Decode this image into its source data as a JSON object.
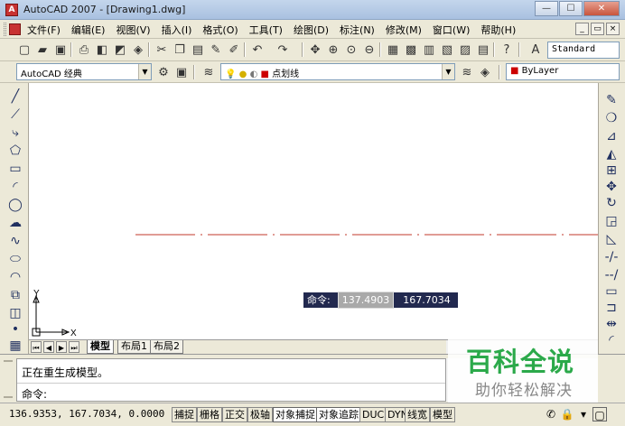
{
  "window": {
    "title": "AutoCAD 2007 - [Drawing1.dwg]"
  },
  "menubar": {
    "items": [
      "文件(F)",
      "编辑(E)",
      "视图(V)",
      "插入(I)",
      "格式(O)",
      "工具(T)",
      "绘图(D)",
      "标注(N)",
      "修改(M)",
      "窗口(W)",
      "帮助(H)"
    ]
  },
  "toolbar1": {
    "text_style": "Standard"
  },
  "toolbar2": {
    "workspace": "AutoCAD 经典",
    "layer": "点划线",
    "color": "ByLayer"
  },
  "canvas": {
    "ucs": {
      "x": "X",
      "y": "Y"
    },
    "dynamic_input": {
      "label": "命令:",
      "value1": "137.4903",
      "value2": "167.7034"
    },
    "centerline_color": "#c0392b"
  },
  "tabs": {
    "model": "模型",
    "layout1": "布局1",
    "layout2": "布局2"
  },
  "command": {
    "history": "正在重生成模型。",
    "prompt": "命令:"
  },
  "status": {
    "coords": "136.9353,  167.7034, 0.0000",
    "buttons": [
      "捕捉",
      "栅格",
      "正交",
      "极轴",
      "对象捕捉",
      "对象追踪",
      "DUCS",
      "DYN",
      "线宽",
      "模型"
    ]
  },
  "watermark": {
    "title": "百科全说",
    "subtitle": "助你轻松解决"
  }
}
